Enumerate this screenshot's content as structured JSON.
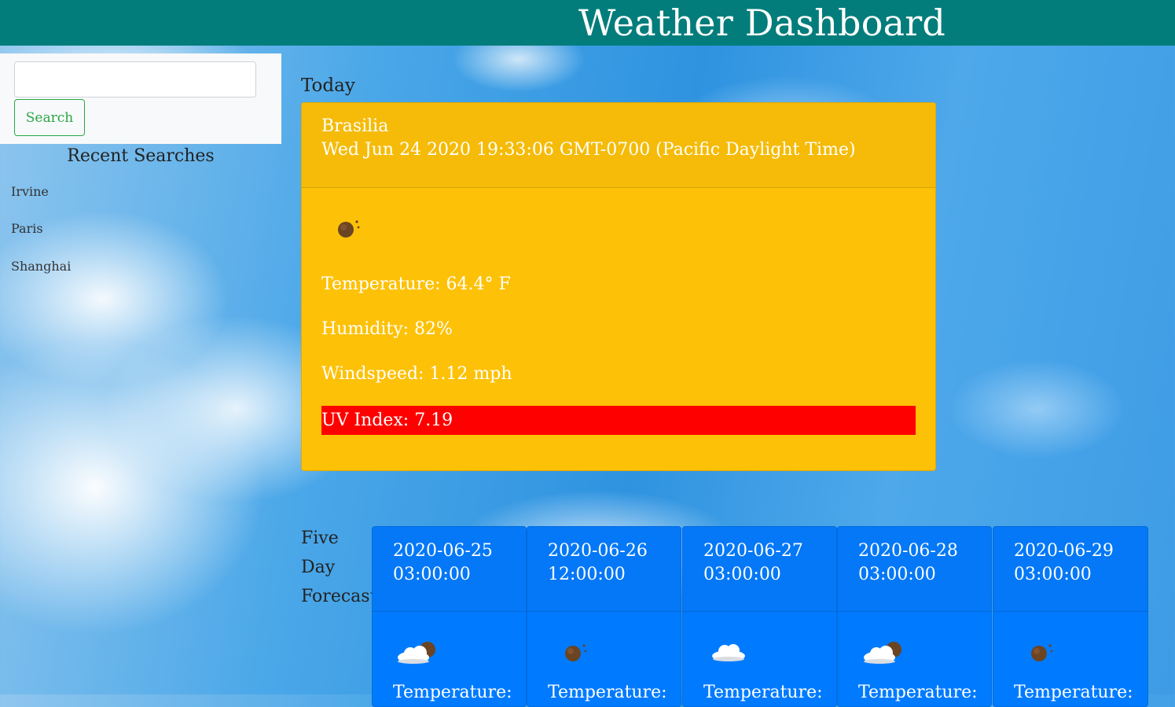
{
  "header": {
    "title": "Weather Dashboard"
  },
  "search": {
    "input_value": "",
    "button_label": "Search"
  },
  "recent": {
    "title": "Recent Searches",
    "items": [
      "Irvine",
      "Paris",
      "Shanghai"
    ]
  },
  "today": {
    "label": "Today",
    "city": "Brasilia",
    "datetime": "Wed Jun 24 2020 19:33:06 GMT-0700 (Pacific Daylight Time)",
    "icon": "clear-night-icon",
    "temperature": "Temperature: 64.4° F",
    "humidity": "Humidity: 82%",
    "windspeed": "Windspeed: 1.12 mph",
    "uv": "UV Index: 7.19",
    "uv_color": "#ff0000"
  },
  "forecast": {
    "label_words": [
      "Five",
      "Day",
      "Forecast"
    ],
    "days": [
      {
        "date": "2020-06-25",
        "time": "03:00:00",
        "icon": "cloudy-night-icon",
        "temp_label": "Temperature:"
      },
      {
        "date": "2020-06-26",
        "time": "12:00:00",
        "icon": "clear-night-icon",
        "temp_label": "Temperature:"
      },
      {
        "date": "2020-06-27",
        "time": "03:00:00",
        "icon": "cloud-icon",
        "temp_label": "Temperature:"
      },
      {
        "date": "2020-06-28",
        "time": "03:00:00",
        "icon": "cloudy-night-icon",
        "temp_label": "Temperature:"
      },
      {
        "date": "2020-06-29",
        "time": "03:00:00",
        "icon": "clear-night-icon",
        "temp_label": "Temperature:"
      }
    ]
  },
  "colors": {
    "header_bg": "#037d7b",
    "today_card_bg": "#fdc107",
    "forecast_card_bg": "#007bff",
    "search_button": "#28a745"
  }
}
